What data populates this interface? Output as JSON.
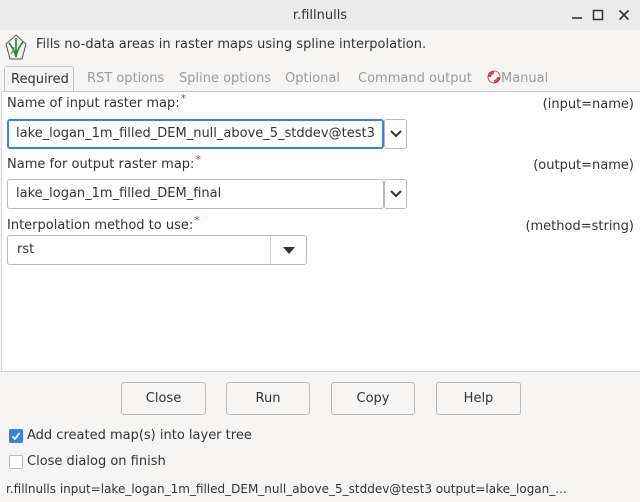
{
  "window": {
    "title": "r.fillnulls"
  },
  "description": "Fills no-data areas in raster maps using spline interpolation.",
  "tabs": [
    {
      "label": "Required"
    },
    {
      "label": "RST options"
    },
    {
      "label": "Spline options"
    },
    {
      "label": "Optional"
    },
    {
      "label": "Command output"
    },
    {
      "label": "Manual"
    }
  ],
  "fields": {
    "input": {
      "label": "Name of input raster map:",
      "required_mark": "*",
      "hint": "(input=name)",
      "value": "lake_logan_1m_filled_DEM_null_above_5_stddev@test3"
    },
    "output": {
      "label": "Name for output raster map:",
      "required_mark": "*",
      "hint": "(output=name)",
      "value": "lake_logan_1m_filled_DEM_final"
    },
    "method": {
      "label": "Interpolation method to use:",
      "required_mark": "*",
      "hint": "(method=string)",
      "value": "rst"
    }
  },
  "buttons": {
    "close": "Close",
    "run": "Run",
    "copy": "Copy",
    "help": "Help"
  },
  "options": {
    "add_to_tree": {
      "label": "Add created map(s) into layer tree",
      "checked": true
    },
    "close_on_finish": {
      "label": "Close dialog on finish",
      "checked": false
    }
  },
  "statusbar": "r.fillnulls input=lake_logan_1m_filled_DEM_null_above_5_stddev@test3 output=lake_logan_...",
  "colors": {
    "accent": "#3584e4",
    "required": "#d62b2b",
    "inactive_tab": "#9a9a9a"
  },
  "icons": {
    "app_logo": "grass-logo-icon",
    "manual_tab": "lifebuoy-icon"
  }
}
